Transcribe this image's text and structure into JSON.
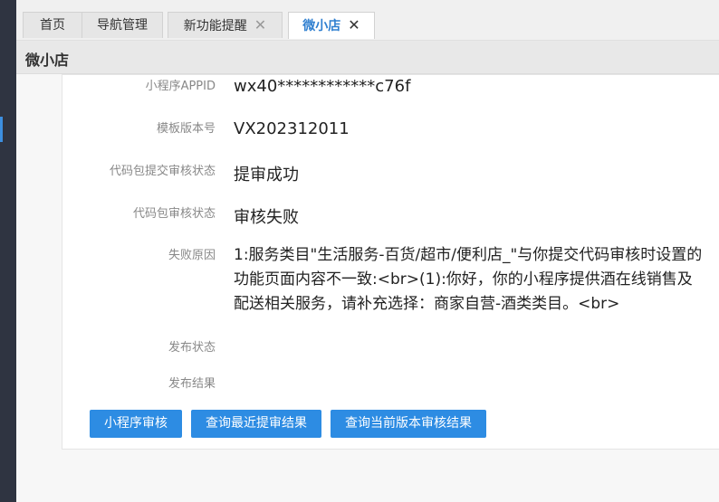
{
  "tabs": [
    {
      "label": "首页"
    },
    {
      "label": "导航管理"
    },
    {
      "label": "新功能提醒",
      "close": "✕"
    },
    {
      "label": "微小店",
      "close": "✕"
    }
  ],
  "page": {
    "title": "微小店"
  },
  "fields": [
    {
      "label": "小程序APPID",
      "value": "wx40************c76f"
    },
    {
      "label": "模板版本号",
      "value": "VX202312011"
    },
    {
      "label": "代码包提交审核状态",
      "value": "提审成功"
    },
    {
      "label": "代码包审核状态",
      "value": "审核失败"
    },
    {
      "label": "失败原因",
      "value": "1:服务类目\"生活服务-百货/超市/便利店_\"与你提交代码审核时设置的功能页面内容不一致:<br>(1):你好，你的小程序提供酒在线销售及配送相关服务，请补充选择：商家自营-酒类类目。<br>"
    },
    {
      "label": "发布状态",
      "value": ""
    },
    {
      "label": "发布结果",
      "value": ""
    }
  ],
  "buttons": {
    "audit": "小程序审核",
    "query_latest": "查询最近提审结果",
    "query_current": "查询当前版本审核结果"
  }
}
